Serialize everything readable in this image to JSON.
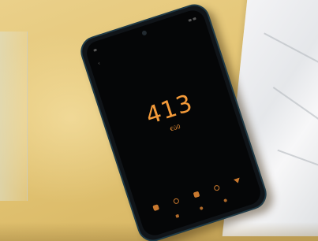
{
  "scene": {
    "description_tags": [
      "table-surface",
      "plastic-sheet",
      "glass-edge",
      "smartphone"
    ]
  },
  "phone": {
    "reading_value": "413",
    "reading_unit": "€ü0",
    "accent_color": "#f39a3a",
    "bottom_icons": [
      "square-icon",
      "circle-icon",
      "square-icon",
      "circle-icon",
      "triangle-icon"
    ],
    "nav_icons": [
      "recent-apps-icon",
      "home-icon",
      "back-icon"
    ]
  }
}
